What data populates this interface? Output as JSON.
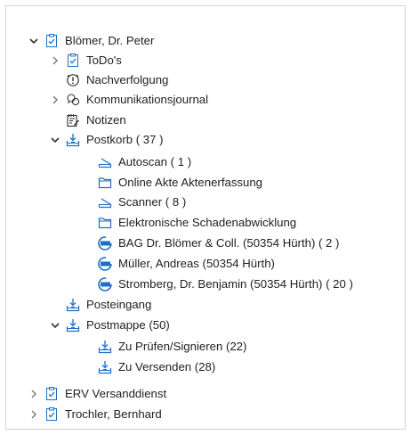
{
  "tree": {
    "root": {
      "label": "Blömer, Dr. Peter"
    },
    "todos": {
      "label": "ToDo's"
    },
    "nachverfolgung": {
      "label": "Nachverfolgung"
    },
    "kommunikation": {
      "label": "Kommunikationsjournal"
    },
    "notizen": {
      "label": "Notizen"
    },
    "postkorb": {
      "label": "Postkorb ( 37 )"
    },
    "autoscan": {
      "label": "Autoscan ( 1 )"
    },
    "online_akte": {
      "label": "Online Akte Aktenerfassung"
    },
    "scanner": {
      "label": "Scanner ( 8 )"
    },
    "elektronische": {
      "label": "Elektronische Schadenabwicklung"
    },
    "bag": {
      "label": "BAG Dr. Blömer & Coll. (50354 Hürth) ( 2 )"
    },
    "mueller": {
      "label": "Müller, Andreas (50354 Hürth)"
    },
    "stromberg": {
      "label": "Stromberg, Dr. Benjamin (50354 Hürth) ( 20 )"
    },
    "posteingang": {
      "label": "Posteingang"
    },
    "postmappe": {
      "label": "Postmappe (50)"
    },
    "zu_pruefen": {
      "label": "Zu Prüfen/Signieren (22)"
    },
    "zu_versenden": {
      "label": "Zu Versenden (28)"
    },
    "erv": {
      "label": "ERV Versanddienst"
    },
    "trochler": {
      "label": "Trochler, Bernhard"
    }
  },
  "colors": {
    "icon_blue": "#1e6fc6",
    "text": "#1f1f1f",
    "border": "#d4d4d4"
  }
}
